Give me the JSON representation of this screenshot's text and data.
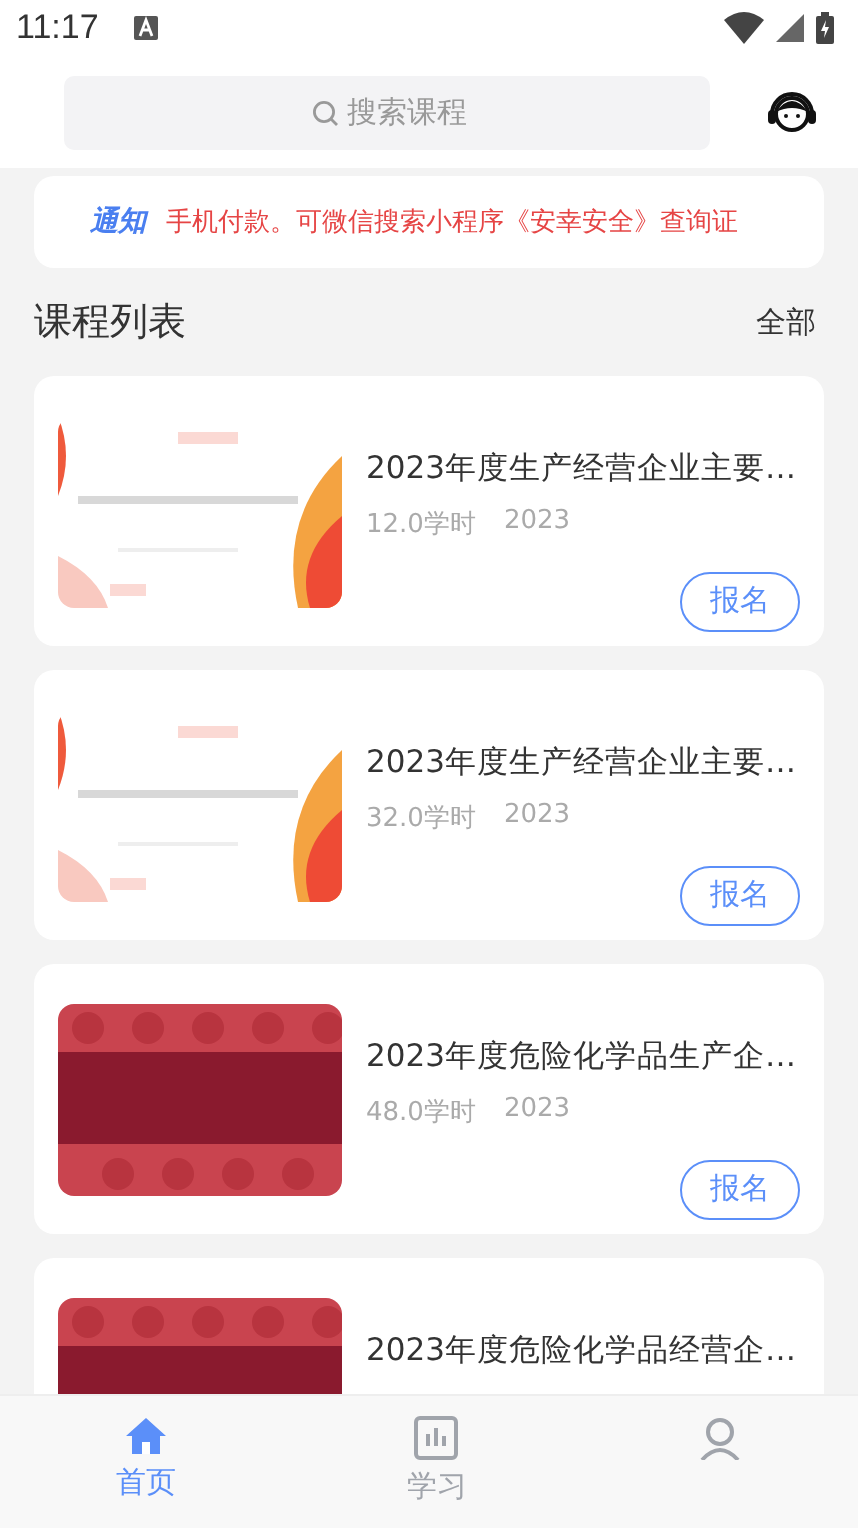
{
  "status_bar": {
    "time": "11:17"
  },
  "search": {
    "placeholder": "搜索课程"
  },
  "notice": {
    "label": "通知",
    "text": "手机付款。可微信搜索小程序《安幸安全》查询证"
  },
  "section": {
    "title": "课程列表",
    "link": "全部"
  },
  "courses": [
    {
      "kind": "picture",
      "title": "2023年度生产经营企业主要…",
      "hours": "12.0学时",
      "year": "2023",
      "button": "报名"
    },
    {
      "kind": "picture",
      "title": "2023年度生产经营企业主要…",
      "hours": "32.0学时",
      "year": "2023",
      "button": "报名"
    },
    {
      "kind": "picture",
      "title": "2023年度危险化学品生产企…",
      "hours": "48.0学时",
      "year": "2023",
      "button": "报名"
    },
    {
      "kind": "picture",
      "title": "2023年度危险化学品经营企…"
    }
  ],
  "tabs": [
    {
      "label": "首页",
      "selected": true
    },
    {
      "label": "学习",
      "selected": false
    },
    {
      "selected": false
    }
  ]
}
